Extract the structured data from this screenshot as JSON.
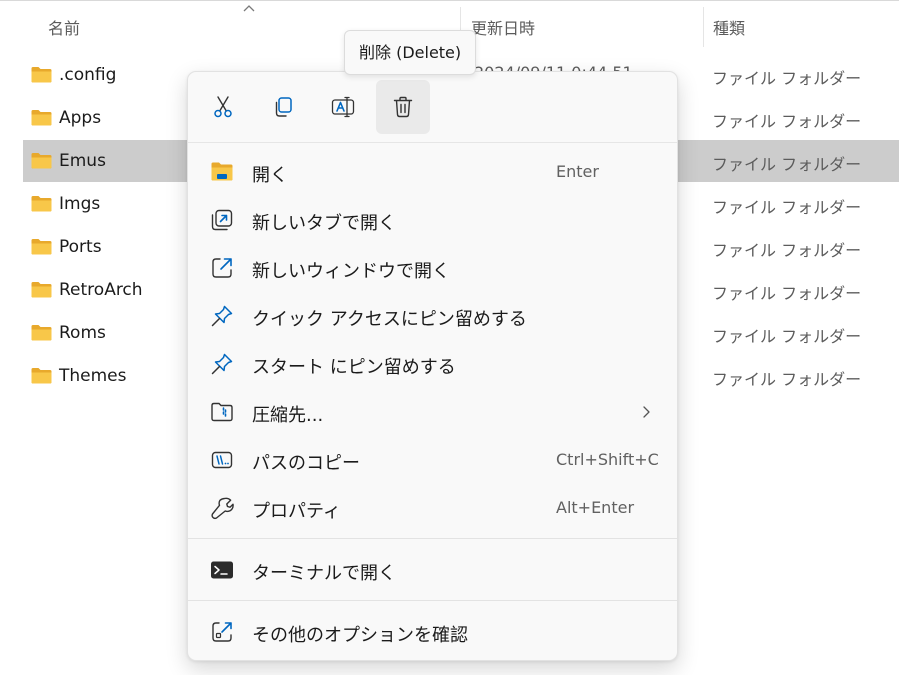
{
  "header": {
    "name": "名前",
    "modified": "更新日時",
    "type": "種類"
  },
  "files": [
    {
      "name": ".config",
      "type": "ファイル フォルダー",
      "selected": false
    },
    {
      "name": "Apps",
      "type": "ファイル フォルダー",
      "selected": false
    },
    {
      "name": "Emus",
      "type": "ファイル フォルダー",
      "selected": true
    },
    {
      "name": "Imgs",
      "type": "ファイル フォルダー",
      "selected": false
    },
    {
      "name": "Ports",
      "type": "ファイル フォルダー",
      "selected": false
    },
    {
      "name": "RetroArch",
      "type": "ファイル フォルダー",
      "selected": false
    },
    {
      "name": "Roms",
      "type": "ファイル フォルダー",
      "selected": false
    },
    {
      "name": "Themes",
      "type": "ファイル フォルダー",
      "selected": false
    }
  ],
  "tooltip": {
    "text": "削除 (Delete)"
  },
  "ghost_date": "2024/09/11 0:44 51",
  "toolbar": {
    "buttons": [
      {
        "icon": "scissors-icon",
        "name": "cut-button"
      },
      {
        "icon": "copy-icon",
        "name": "copy-button"
      },
      {
        "icon": "rename-icon",
        "name": "rename-button"
      },
      {
        "icon": "trash-icon",
        "name": "delete-button"
      }
    ]
  },
  "menu": {
    "open": {
      "label": "開く",
      "shortcut": "Enter"
    },
    "open_new_tab": {
      "label": "新しいタブで開く"
    },
    "open_new_window": {
      "label": "新しいウィンドウで開く"
    },
    "pin_quick_access": {
      "label": "クイック アクセスにピン留めする"
    },
    "pin_start": {
      "label": "スタート にピン留めする"
    },
    "compress": {
      "label": "圧縮先..."
    },
    "copy_path": {
      "label": "パスのコピー",
      "shortcut": "Ctrl+Shift+C"
    },
    "properties": {
      "label": "プロパティ",
      "shortcut": "Alt+Enter"
    },
    "open_terminal": {
      "label": "ターミナルで開く"
    },
    "more_options": {
      "label": "その他のオプションを確認"
    }
  },
  "colors": {
    "folder_yellow": "#f8c749",
    "folder_dark": "#e8a92c",
    "accent_blue": "#0067c0",
    "selected_row": "#cccccc"
  }
}
